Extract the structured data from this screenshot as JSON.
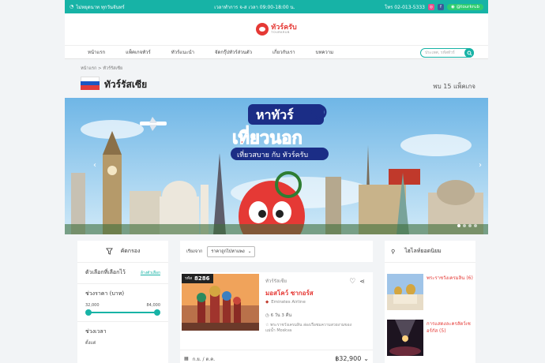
{
  "topbar": {
    "hours_label": "ไม่หยุดนาท ทุกวันจันทร์",
    "office_hours": "เวลาทำการ จ-ส เวลา 09:00-18:00 น.",
    "phone": "โทร 02-013-5333",
    "line_id": "@tourkrub",
    "colors": {
      "bg": "#17b3a6"
    }
  },
  "header": {
    "logo_text": "ทัวร์ครับ",
    "logo_sub": "TOURKRUB"
  },
  "nav": {
    "items": [
      "หน้าแรก",
      "แพ็คเกจทัวร์",
      "ทัวร์แนะนำ",
      "จัดกรุ๊ปทัวร์ส่วนตัว",
      "เกี่ยวกับเรา",
      "บทความ"
    ],
    "search_placeholder": "ประเทศ, รหัสทัวร์"
  },
  "breadcrumb": "หน้าแรก  >  ทัวร์รัสเซีย",
  "page_title": "ทัวร์รัสเซีย",
  "result_count": "พบ 15 แพ็คเกจ",
  "banner": {
    "headline_small": "หาทัวร์",
    "headline": "เที่ยวนอก",
    "tagline": "เที่ยวสบาย กับ ทัวร์ครับ"
  },
  "filter": {
    "title": "คัดกรอง",
    "selected_label": "ตัวเลือกที่เลือกไว้",
    "clear_label": "ล้างตัวเลือก",
    "price_label": "ช่วงราคา (บาท)",
    "price_min": "32,000",
    "price_max": "84,000",
    "period_label": "ช่วงเวลา",
    "period_value": "ตั้งแต่"
  },
  "sort": {
    "label": "เรียงจาก",
    "selected": "ราคาถูกไปหาแพง"
  },
  "tour_card": {
    "code_prefix": "รหัส",
    "code": "8286",
    "category": "ทัวร์รัสเซีย",
    "name": "มอสโคว์ ซากอร์ส",
    "airline": "Emirates Airline",
    "duration": "6 วัน 3 คืน",
    "highlight": "พระราชวังเครมลิน ล่องเรือชมความสวยงามของแม่น้ำ Moskva",
    "dates": "ก.ย. / ต.ค.",
    "price": "฿32,900"
  },
  "popular": {
    "title": "ไฮไลท์ยอดนิยม",
    "items": [
      {
        "label": "พระราชวังเครมลิน",
        "count": "(6)"
      },
      {
        "label": "การแสดงละครสัตว์เซอร์กัส",
        "count": "(5)"
      }
    ]
  },
  "colors": {
    "accent": "#17b3a6",
    "brand": "#e53935"
  }
}
